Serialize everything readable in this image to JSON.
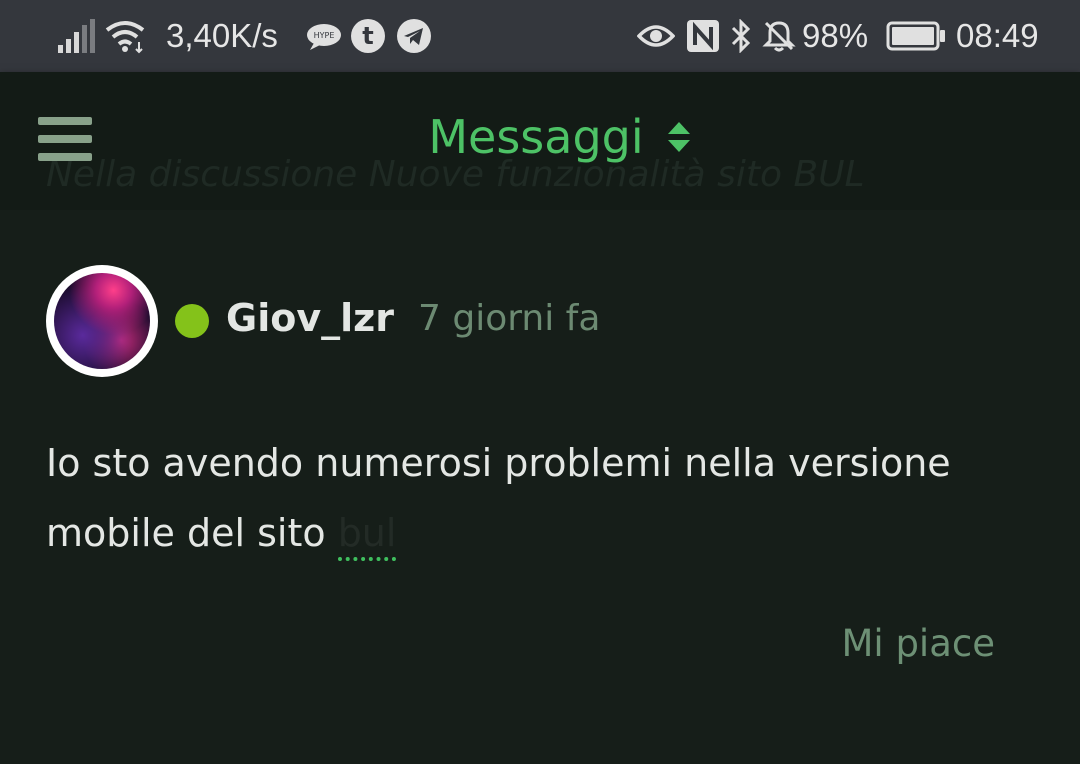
{
  "status_bar": {
    "network_speed": "3,40K/s",
    "battery": "98%",
    "time": "08:49",
    "hype_label": "HYPE",
    "icons": [
      "signal-icon",
      "wifi-icon",
      "hype-icon",
      "tumblr-icon",
      "telegram-icon",
      "eye-icon",
      "nfc-icon",
      "bluetooth-icon",
      "bell-off-icon",
      "battery-icon"
    ]
  },
  "header": {
    "title": "Messaggi",
    "ghost_text": "Nella discussione Nuove funzionalità sito BUL",
    "accent_color": "#4dc266"
  },
  "post": {
    "username": "Giov_lzr",
    "time_ago": "7 giorni fa",
    "body_text": "Io sto avendo numerosi problemi nella versione mobile del sito ",
    "mention": "bul",
    "like_label": "Mi piace",
    "online_color": "#84c21a"
  }
}
